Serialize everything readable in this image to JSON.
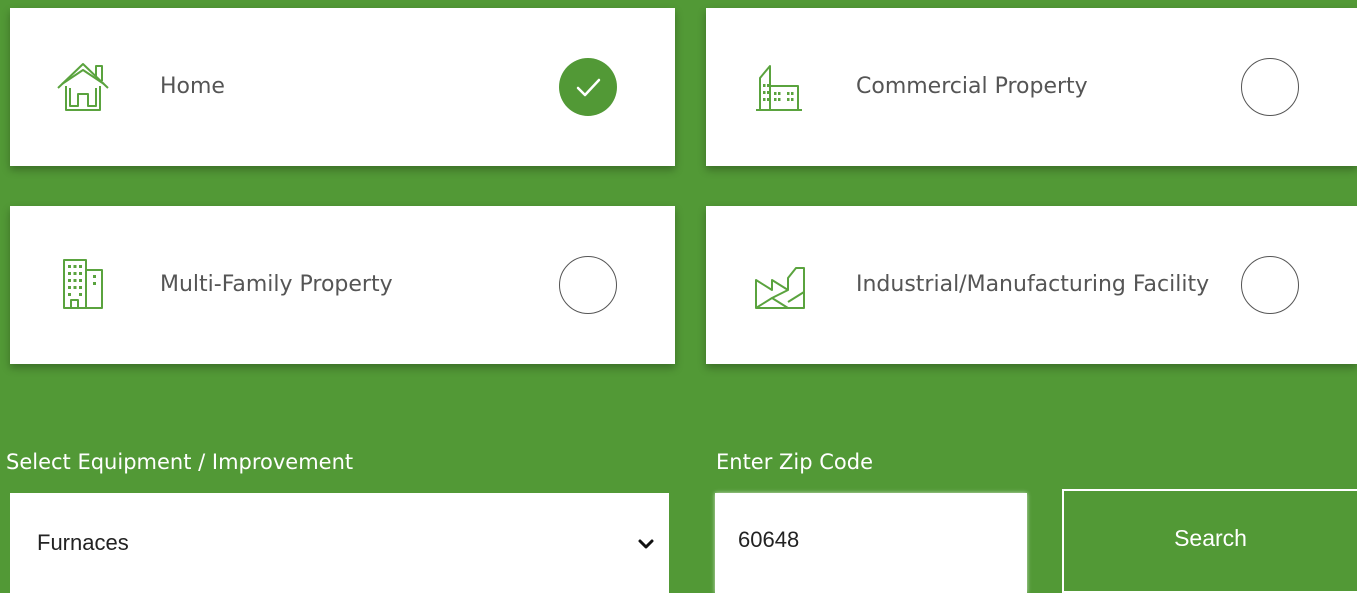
{
  "property_types": [
    {
      "label": "Home",
      "icon": "house-icon",
      "selected": true
    },
    {
      "label": "Commercial Property",
      "icon": "commercial-building-icon",
      "selected": false
    },
    {
      "label": "Multi-Family Property",
      "icon": "apartment-building-icon",
      "selected": false
    },
    {
      "label": "Industrial/Manufacturing Facility",
      "icon": "factory-icon",
      "selected": false
    }
  ],
  "equipment": {
    "label": "Select Equipment / Improvement",
    "selected_value": "Furnaces"
  },
  "zip": {
    "label": "Enter Zip Code",
    "value": "60648"
  },
  "search": {
    "label": "Search"
  },
  "colors": {
    "brand_green": "#529936",
    "icon_green": "#5aa33e",
    "text_gray": "#555555"
  }
}
